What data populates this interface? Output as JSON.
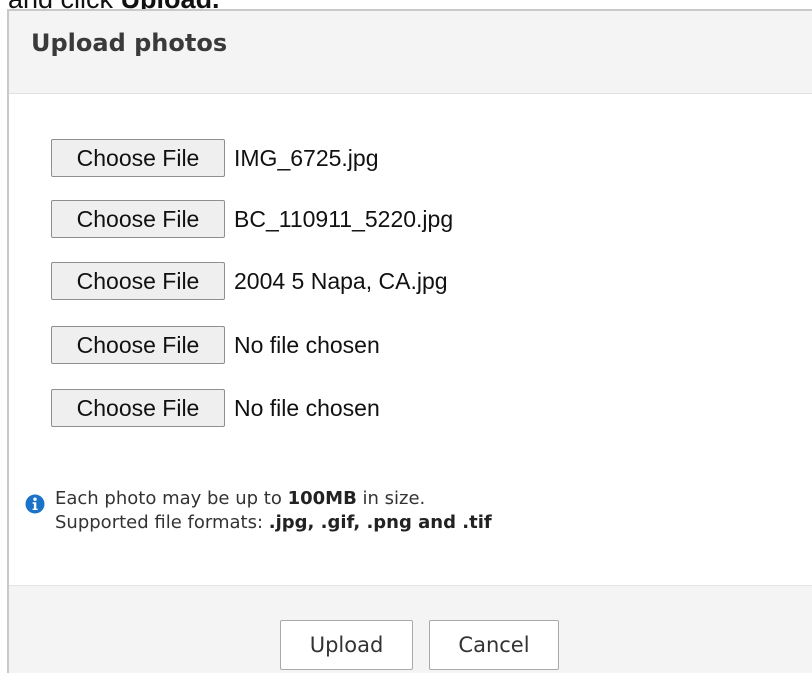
{
  "caption": {
    "prefix": "and click ",
    "emphasis": "Upload."
  },
  "dialog": {
    "title": "Upload photos",
    "file_inputs": [
      {
        "button_label": "Choose File",
        "file_name": "IMG_6725.jpg"
      },
      {
        "button_label": "Choose File",
        "file_name": "BC_110911_5220.jpg"
      },
      {
        "button_label": "Choose File",
        "file_name": "2004 5 Napa, CA.jpg"
      },
      {
        "button_label": "Choose File",
        "file_name": "No file chosen"
      },
      {
        "button_label": "Choose File",
        "file_name": "No file chosen"
      }
    ],
    "info": {
      "icon": "info-icon",
      "line1_prefix": "Each photo may be up to ",
      "line1_size": "100MB",
      "line1_suffix": " in size.",
      "line2_prefix": "Supported file formats: ",
      "line2_formats": ".jpg, .gif, .png and .tif"
    },
    "footer": {
      "upload_label": "Upload",
      "cancel_label": "Cancel"
    }
  },
  "colors": {
    "header_bg": "#f4f4f4",
    "info_icon": "#1a73c9",
    "border": "#c9c9c9"
  }
}
